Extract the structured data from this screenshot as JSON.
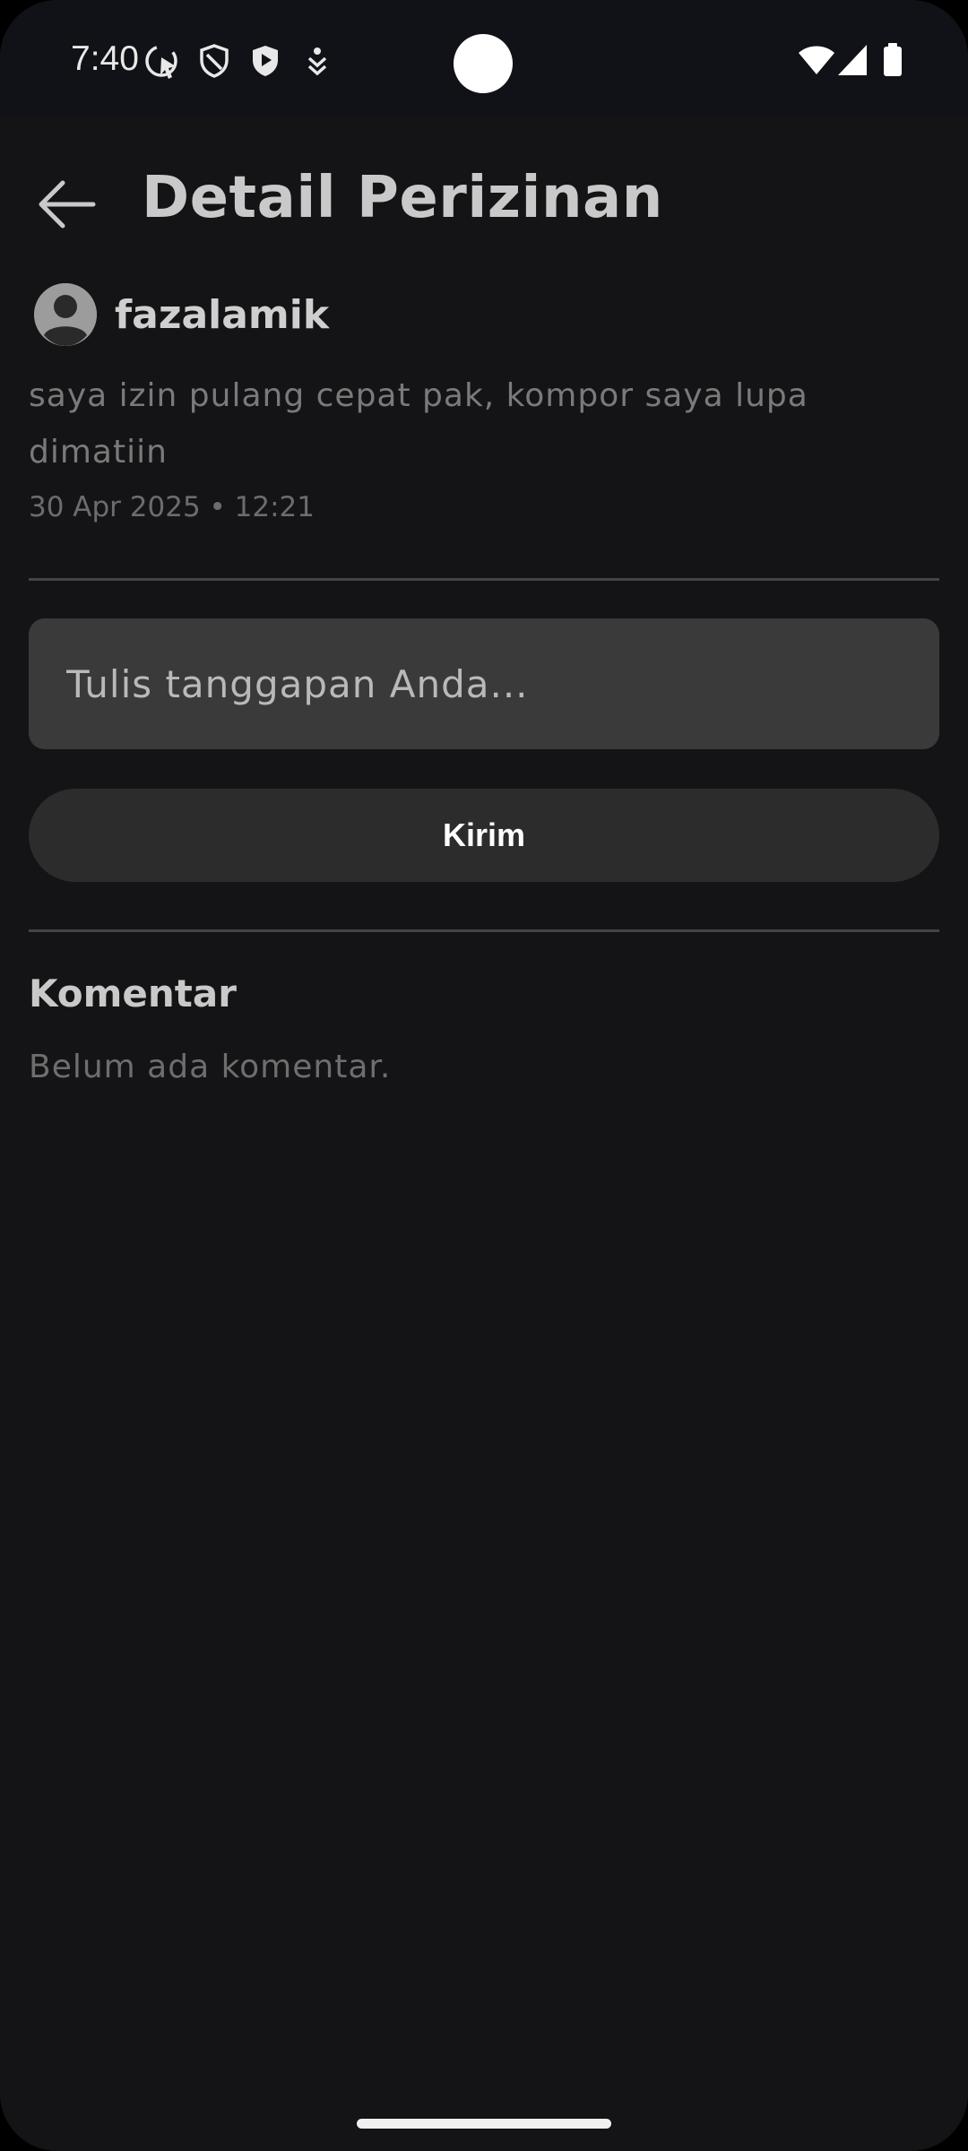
{
  "status_bar": {
    "time": "7:40",
    "left_icons": [
      "cursor-ring-icon",
      "shield-outline-icon",
      "shield-play-icon",
      "download-arrow-icon"
    ],
    "right_icons": [
      "wifi-icon",
      "signal-icon",
      "battery-icon"
    ]
  },
  "header": {
    "back_icon": "arrow-left-icon",
    "title": "Detail Perizinan"
  },
  "request": {
    "avatar_icon": "account-circle-icon",
    "author": "fazalamik",
    "message": "saya izin pulang cepat pak, kompor saya lupa dimatiin",
    "datetime": "30 Apr 2025 • 12:21"
  },
  "reply": {
    "placeholder": "Tulis tanggapan Anda...",
    "value": "",
    "send_label": "Kirim"
  },
  "comments": {
    "heading": "Komentar",
    "empty_text": "Belum ada komentar."
  },
  "colors": {
    "background": "#141416",
    "input_background": "#3a3a3a",
    "button_background": "#2c2c2c",
    "title_text": "#c9c9c9",
    "muted_text": "#7a7a7a"
  }
}
